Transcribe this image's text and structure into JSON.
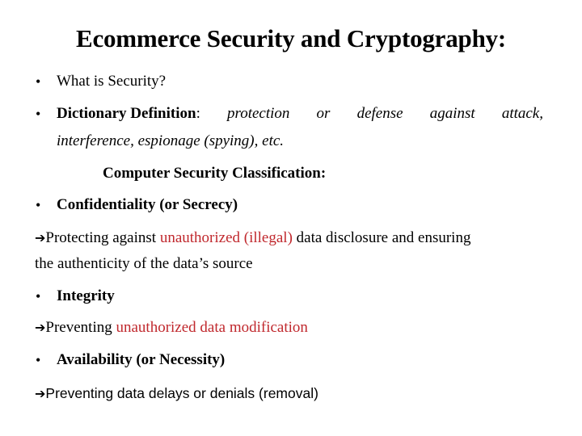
{
  "slide": {
    "title": "Ecommerce Security and Cryptography:",
    "bullet_glyph": "•",
    "arrow_glyph": "➔",
    "accent_color": "#c0282d",
    "items": {
      "what_is_security": "What is Security?",
      "dictionary": {
        "label": "Dictionary Definition",
        "colon": ":",
        "line1_words": [
          "protection",
          "or",
          "defense",
          "against",
          "attack,"
        ],
        "line2": "interference, espionage (spying), etc."
      },
      "classification_heading": "Computer Security Classification:",
      "confidentiality": {
        "heading": "Confidentiality (or Secrecy)",
        "desc_pre": "Protecting against ",
        "desc_highlight": "unauthorized (illegal)",
        "desc_post": " data disclosure and ensuring",
        "desc_line2": "the authenticity of the data’s source"
      },
      "integrity": {
        "heading": "Integrity",
        "desc_pre": "Preventing ",
        "desc_highlight": "unauthorized data modification"
      },
      "availability": {
        "heading": "Availability (or Necessity)",
        "desc": "Preventing data delays or denials (removal)"
      }
    }
  }
}
